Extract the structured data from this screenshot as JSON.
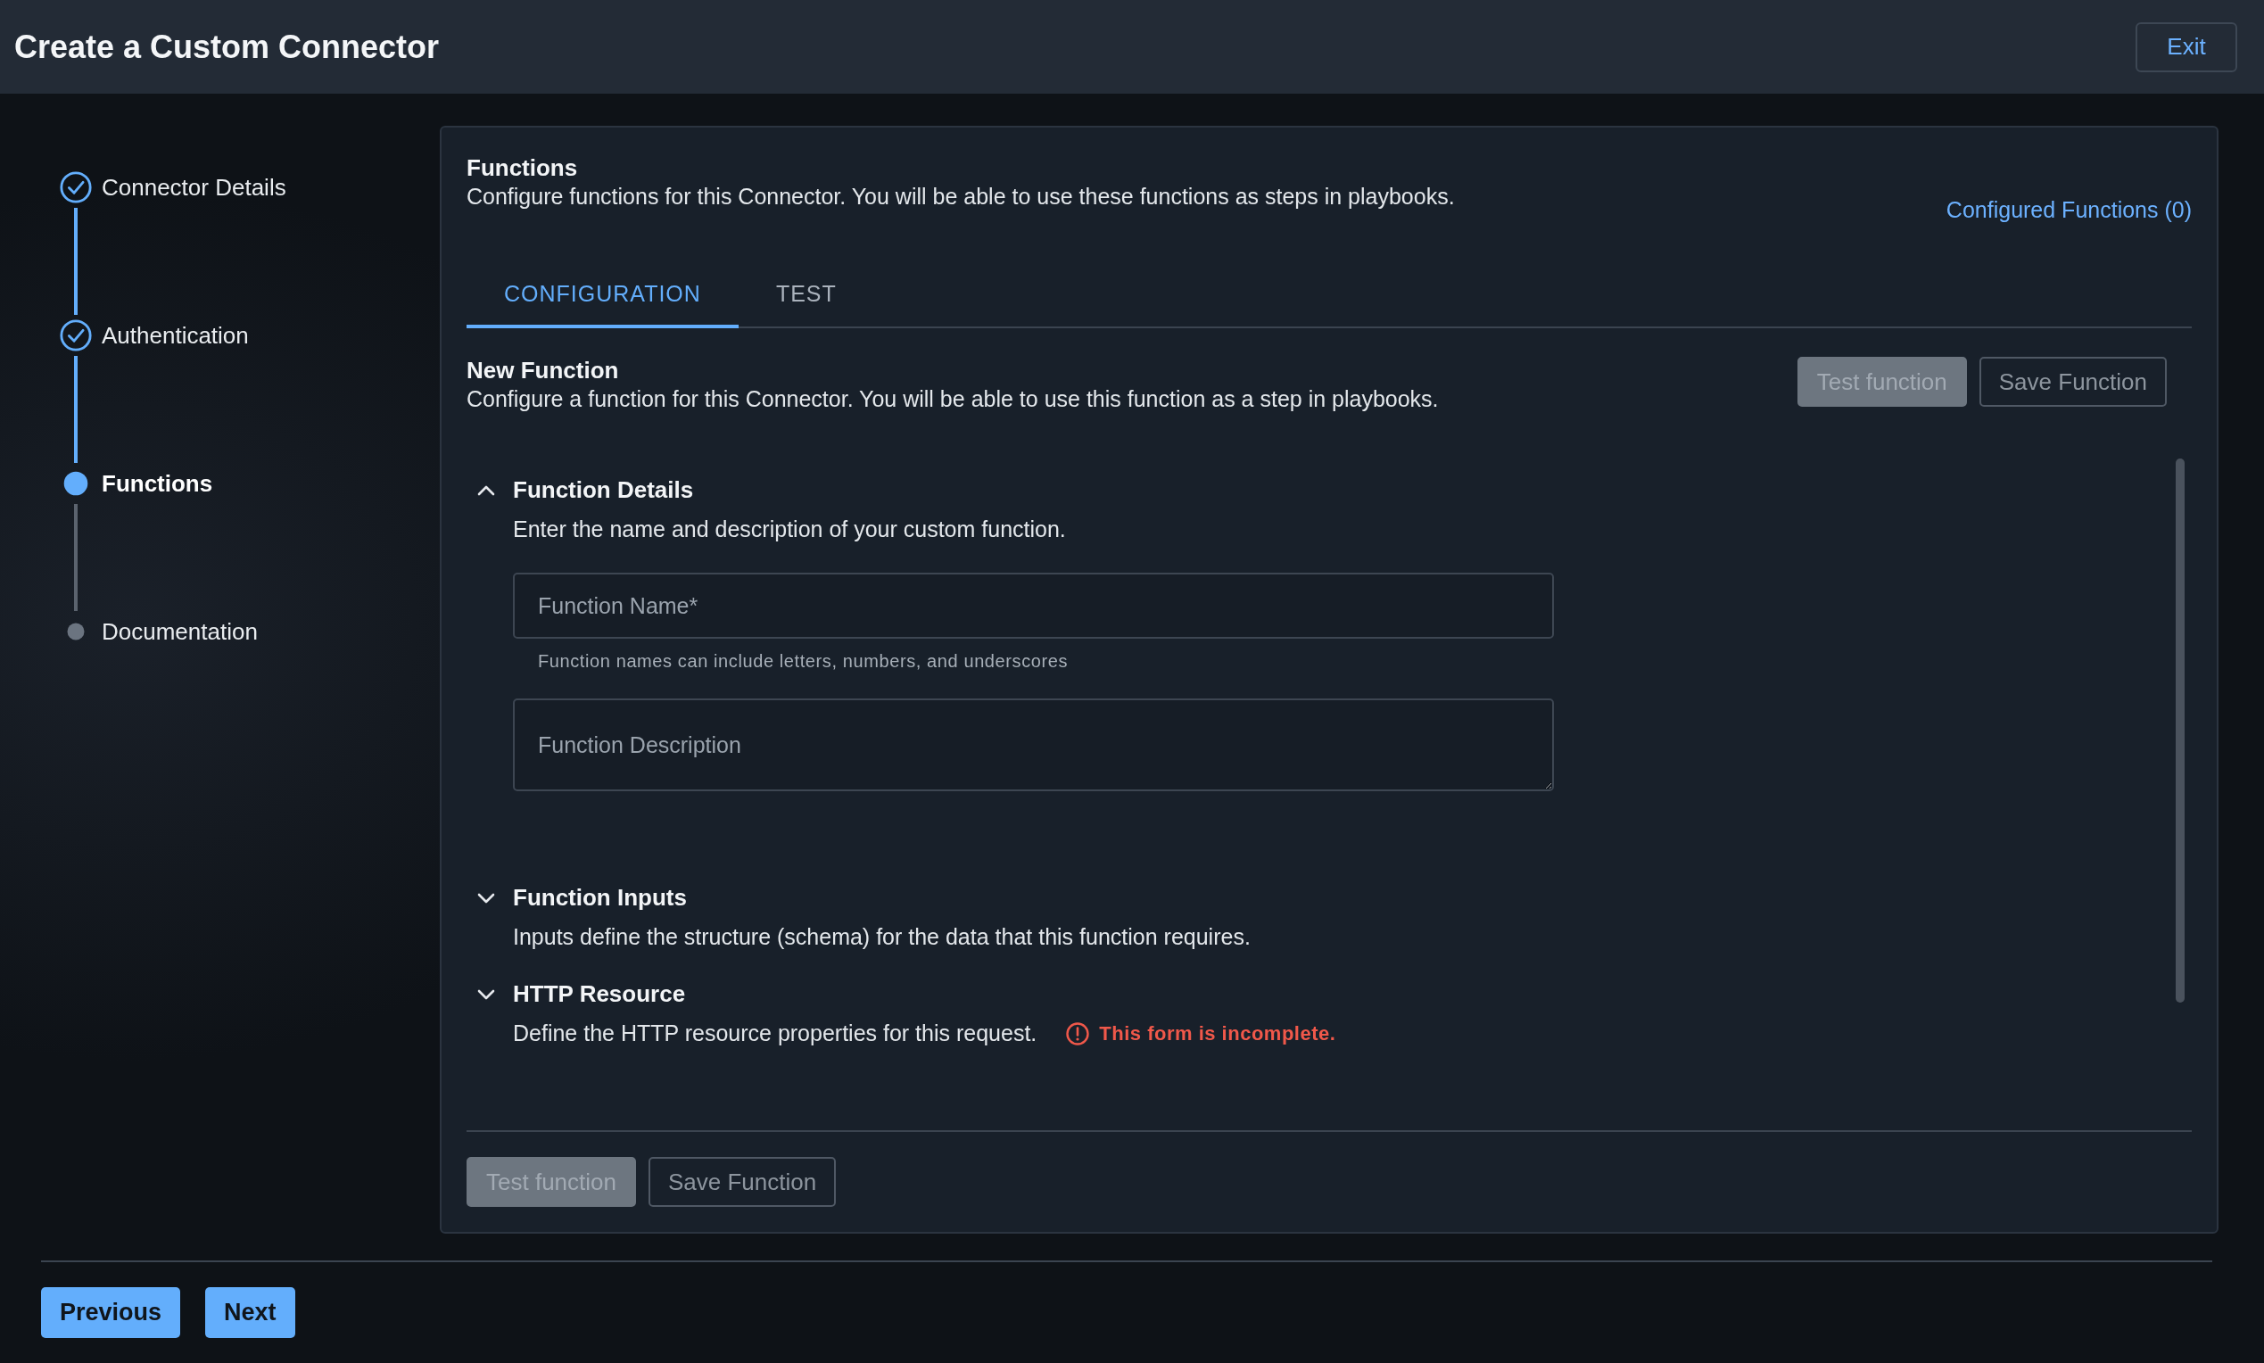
{
  "header": {
    "title": "Create a Custom Connector",
    "exit_button": "Exit"
  },
  "steps": [
    {
      "label": "Connector Details",
      "completed": true,
      "selected": false
    },
    {
      "label": "Authentication",
      "completed": true,
      "selected": false
    },
    {
      "label": "Functions",
      "completed": false,
      "selected": true
    },
    {
      "label": "Documentation",
      "completed": false,
      "selected": false
    }
  ],
  "panel": {
    "title": "Functions",
    "description": "Configure functions for this Connector. You will be able to use these functions as steps in playbooks.",
    "configured_link": "Configured Functions (0)",
    "tabs": [
      {
        "label": "CONFIGURATION",
        "selected": true
      },
      {
        "label": "TEST",
        "selected": false
      }
    ],
    "new_function": {
      "title": "New Function",
      "description": "Configure a function for this Connector. You will be able to use this function as a step in playbooks.",
      "actions": [
        {
          "label": "Test function",
          "kind": "filled",
          "disabled": true
        },
        {
          "label": "Save Function",
          "kind": "outline",
          "disabled": true
        }
      ]
    },
    "sections": [
      {
        "title": "Function Details",
        "description": "Enter the name and description of your custom function.",
        "expanded": true,
        "fields": [
          {
            "kind": "input",
            "placeholder": "Function Name*",
            "helper": "Function names can include letters, numbers, and underscores"
          },
          {
            "kind": "textarea",
            "placeholder": "Function Description"
          }
        ]
      },
      {
        "title": "Function Inputs",
        "description": "Inputs define the structure (schema) for the data that this function requires.",
        "expanded": false
      },
      {
        "title": "HTTP Resource",
        "description": "Define the HTTP resource properties for this request.",
        "expanded": false,
        "error": "This form is incomplete."
      }
    ],
    "footer_actions": [
      {
        "label": "Test function",
        "kind": "filled",
        "disabled": true
      },
      {
        "label": "Save Function",
        "kind": "outline",
        "disabled": true
      }
    ]
  },
  "nav_buttons": [
    {
      "label": "Previous"
    },
    {
      "label": "Next"
    }
  ]
}
